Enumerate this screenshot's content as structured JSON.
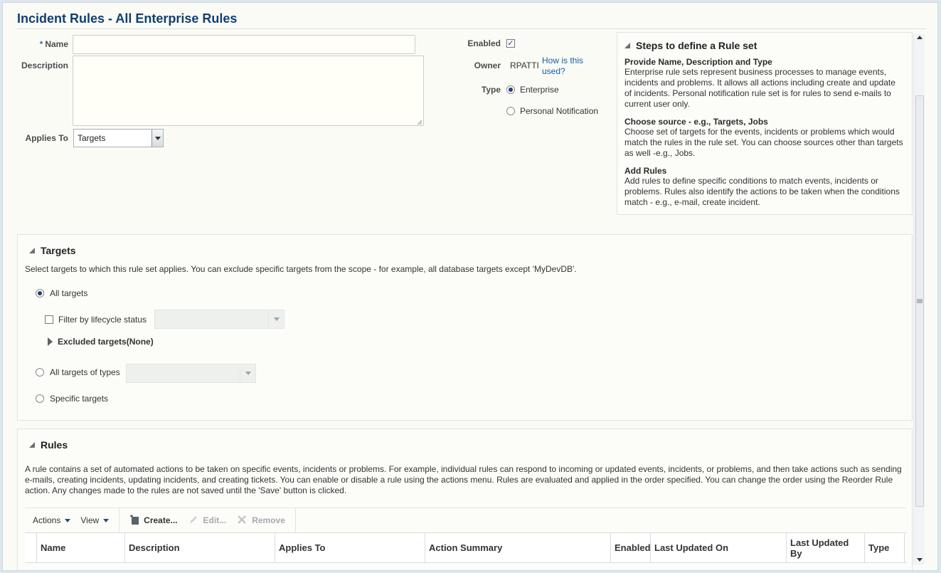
{
  "page": {
    "title": "Incident Rules - All Enterprise Rules"
  },
  "form": {
    "required_mark": "*",
    "name_label": "Name",
    "name_value": "",
    "description_label": "Description",
    "description_value": "",
    "applies_to_label": "Applies To",
    "applies_to_value": "Targets",
    "enabled_label": "Enabled",
    "enabled_checked": true,
    "owner_label": "Owner",
    "owner_value": "RPATTI",
    "owner_help_link": "How is this used?",
    "type_label": "Type",
    "type_options": [
      "Enterprise",
      "Personal Notification"
    ],
    "type_selected": "Enterprise"
  },
  "steps": {
    "title": "Steps to define a Rule set",
    "items": [
      {
        "heading": "Provide Name, Description and Type",
        "text": "Enterprise rule sets represent business processes to manage events, incidents and problems. It allows all actions including create and update of incidents. Personal notification rule set is for rules to send e-mails to current user only."
      },
      {
        "heading": "Choose source - e.g., Targets, Jobs",
        "text": "Choose set of targets for the events, incidents or problems which would match the rules in the rule set. You can choose sources other than targets as well -e.g., Jobs."
      },
      {
        "heading": "Add Rules",
        "text": "Add rules to define specific conditions to match events, incidents or problems. Rules also identify the actions to be taken when the conditions match - e.g., e-mail, create incident."
      }
    ]
  },
  "targets": {
    "title": "Targets",
    "description": "Select targets to which this rule set applies. You can exclude specific targets from the scope - for example, all database targets except 'MyDevDB'.",
    "all_targets_label": "All targets",
    "filter_lifecycle_label": "Filter by lifecycle status",
    "excluded_label": "Excluded targets(None)",
    "types_label": "All targets of types",
    "specific_label": "Specific targets",
    "selected": "All targets"
  },
  "rules": {
    "title": "Rules",
    "description": "A rule contains a set of automated actions to be taken on specific events, incidents or problems. For example, individual rules can respond to incoming or updated events, incidents, or problems, and then take actions such as sending e-mails, creating incidents, updating incidents, and creating tickets. You can enable or disable a rule using the actions menu. Rules are evaluated and applied in the order specified. You can change the order using the Reorder Rule action. Any changes made to the rules are not saved until the 'Save' button is clicked.",
    "toolbar": {
      "actions": "Actions",
      "view": "View",
      "create": "Create...",
      "edit": "Edit...",
      "remove": "Remove"
    },
    "columns": [
      "Name",
      "Description",
      "Applies To",
      "Action Summary",
      "Enabled",
      "Last Updated On",
      "Last Updated By",
      "Type"
    ]
  },
  "colors": {
    "title": "#0f3f72",
    "link": "#145fa8",
    "background": "#fbfbf6"
  }
}
